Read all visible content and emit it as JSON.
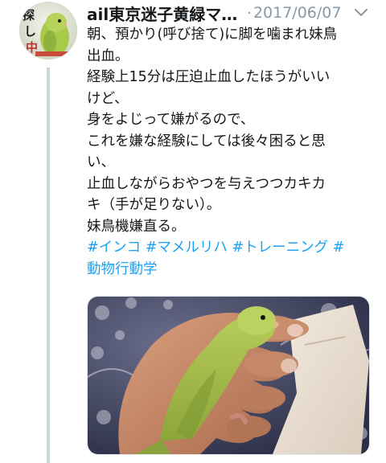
{
  "author": {
    "avatar_badge": "探し中",
    "display_name": "ail東京迷子黄緑マ…"
  },
  "tweet": {
    "separator": "·",
    "date": "2017/06/07",
    "lines": [
      "朝、預かり(呼び捨て)に脚を噛まれ妹鳥",
      "出血。",
      "経験上15分は圧迫止血したほうがいい",
      "けど、",
      "身をよじって嫌がるので、",
      "これを嫌な経験にしては後々困ると思",
      "い、",
      "止血しながらおやつを与えつつカキカ",
      "キ（手が足りない）。",
      "妹鳥機嫌直る。"
    ],
    "hashtags": [
      "#インコ",
      "#マメルリハ",
      "#トレーニング",
      "#",
      "動物行動学"
    ]
  },
  "icons": {
    "menu": "chevron-down-icon",
    "media": "parrotlet-photo"
  },
  "colors": {
    "text": "#14171a",
    "secondary": "#8899a6",
    "link": "#1da1f2",
    "thread": "#ccd6dd"
  }
}
